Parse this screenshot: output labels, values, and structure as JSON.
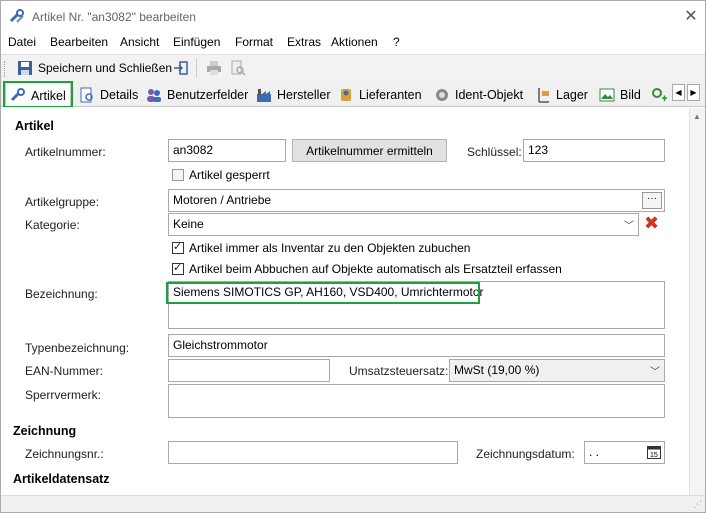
{
  "window": {
    "title": "Artikel Nr. \"an3082\" bearbeiten",
    "close": "✕"
  },
  "menu": [
    {
      "label": "Datei"
    },
    {
      "label": "Bearbeiten"
    },
    {
      "label": "Ansicht"
    },
    {
      "label": "Einfügen"
    },
    {
      "label": "Format"
    },
    {
      "label": "Extras"
    },
    {
      "label": "Aktionen"
    },
    {
      "label": "?"
    }
  ],
  "toolbar": {
    "save_close": "Speichern und Schließen"
  },
  "tabs": [
    {
      "label": "Artikel",
      "icon": "wrench-icon"
    },
    {
      "label": "Details",
      "icon": "document-search-icon"
    },
    {
      "label": "Benutzerfelder",
      "icon": "users-icon"
    },
    {
      "label": "Hersteller",
      "icon": "factory-icon"
    },
    {
      "label": "Lieferanten",
      "icon": "supplier-icon"
    },
    {
      "label": "Ident-Objekt",
      "icon": "object-icon"
    },
    {
      "label": "Lager",
      "icon": "warehouse-icon"
    },
    {
      "label": "Bild",
      "icon": "image-icon"
    }
  ],
  "artikel": {
    "section": "Artikel",
    "nummer_label": "Artikelnummer:",
    "nummer_value": "an3082",
    "ermitteln_button": "Artikelnummer ermitteln",
    "schluessel_label": "Schlüssel:",
    "schluessel_value": "123",
    "gesperrt_label": "Artikel gesperrt",
    "gruppe_label": "Artikelgruppe:",
    "gruppe_value": "Motoren / Antriebe",
    "kategorie_label": "Kategorie:",
    "kategorie_value": "Keine",
    "inventar_label": "Artikel immer als Inventar zu den Objekten zubuchen",
    "ersatzteil_label": "Artikel beim Abbuchen auf Objekte automatisch als Ersatzteil erfassen",
    "bezeichnung_label": "Bezeichnung:",
    "bezeichnung_value": "Siemens SIMOTICS GP, AH160, VSD400, Umrichtermotor",
    "typ_label": "Typenbezeichnung:",
    "typ_value": "Gleichstrommotor",
    "ean_label": "EAN-Nummer:",
    "ean_value": "",
    "ust_label": "Umsatzsteuersatz:",
    "ust_value": "MwSt (19,00 %)",
    "sperr_label": "Sperrvermerk:",
    "sperr_value": ""
  },
  "zeichnung": {
    "section": "Zeichnung",
    "nr_label": "Zeichnungsnr.:",
    "nr_value": "",
    "datum_label": "Zeichnungsdatum:",
    "datum_value": " .  ."
  },
  "artikeldatensatz": {
    "section": "Artikeldatensatz"
  },
  "colors": {
    "highlight": "#1aa33a",
    "delete": "#d3321e"
  }
}
